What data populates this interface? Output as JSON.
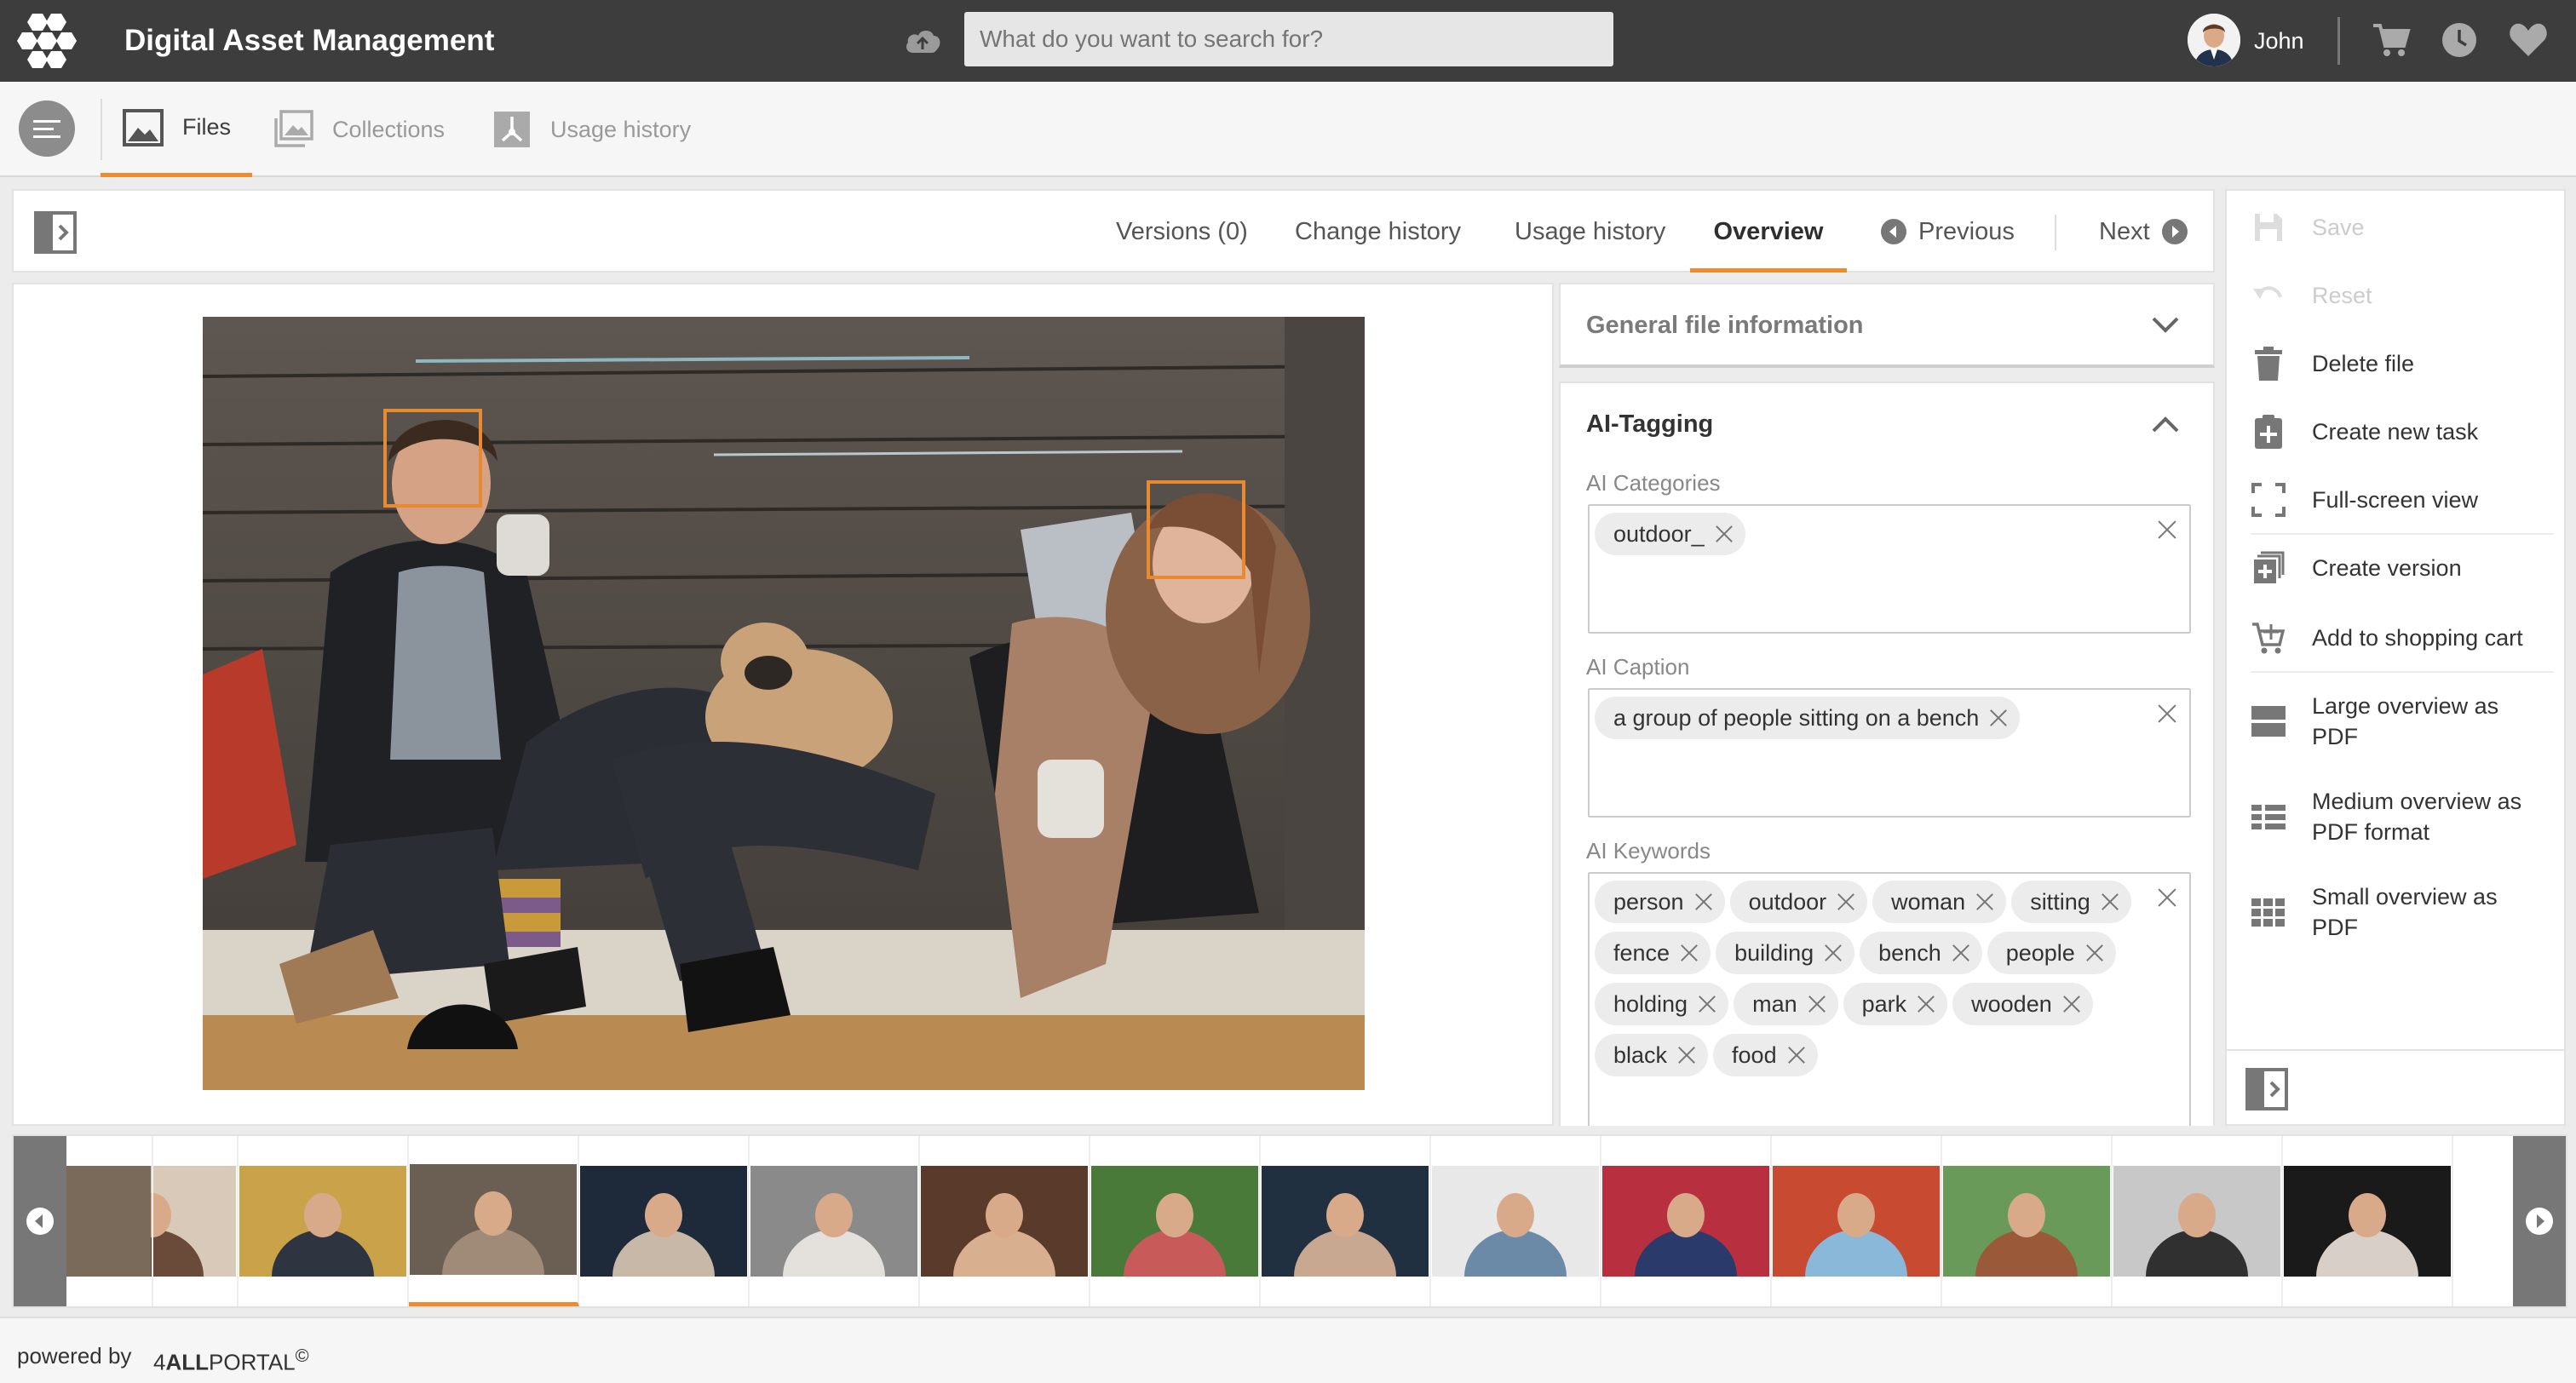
{
  "header": {
    "app_title": "Digital Asset Management",
    "search_placeholder": "What do you want to search for?",
    "user_name": "John"
  },
  "nav": {
    "tabs": [
      {
        "label": "Files",
        "icon": "image-icon",
        "active": true
      },
      {
        "label": "Collections",
        "icon": "collections-icon",
        "active": false
      },
      {
        "label": "Usage history",
        "icon": "usage-icon",
        "active": false
      }
    ]
  },
  "toolbar": {
    "tabs": [
      "Versions (0)",
      "Change history",
      "Usage history",
      "Overview"
    ],
    "active_tab": "Overview",
    "previous": "Previous",
    "next": "Next"
  },
  "info": {
    "general_title": "General file information",
    "ai_title": "AI-Tagging",
    "ai_categories_label": "AI Categories",
    "ai_categories": [
      "outdoor_"
    ],
    "ai_caption_label": "AI Caption",
    "ai_caption": [
      "a group of people sitting on a bench"
    ],
    "ai_keywords_label": "AI Keywords",
    "ai_keywords": [
      "person",
      "outdoor",
      "woman",
      "sitting",
      "fence",
      "building",
      "bench",
      "people",
      "holding",
      "man",
      "park",
      "wooden",
      "black",
      "food"
    ]
  },
  "actions": [
    {
      "label": "Save",
      "icon": "save-icon",
      "enabled": false
    },
    {
      "label": "Reset",
      "icon": "undo-icon",
      "enabled": false
    },
    {
      "label": "Delete file",
      "icon": "trash-icon",
      "enabled": true
    },
    {
      "label": "Create new task",
      "icon": "add-task-icon",
      "enabled": true
    },
    {
      "label": "Full-screen view",
      "icon": "fullscreen-icon",
      "enabled": true
    },
    {
      "label": "Create version",
      "icon": "create-version-icon",
      "enabled": true
    },
    {
      "label": "Add to shopping cart",
      "icon": "add-to-cart-icon",
      "enabled": true
    },
    {
      "label": "Large overview as PDF",
      "icon": "large-overview-icon",
      "enabled": true
    },
    {
      "label": "Medium overview as PDF format",
      "icon": "medium-overview-icon",
      "enabled": true
    },
    {
      "label": "Small overview as PDF",
      "icon": "small-overview-icon",
      "enabled": true
    }
  ],
  "filmstrip": {
    "active_index": 2,
    "thumbnail_count": 14
  },
  "footer": {
    "powered_by": "powered by",
    "brand_prefix": "4",
    "brand_bold": "ALL",
    "brand_suffix": "PORTAL",
    "copyright": "©"
  },
  "colors": {
    "header_bg": "#3d3d3d",
    "accent": "#f08a2c",
    "face_box": "#e88a32"
  }
}
